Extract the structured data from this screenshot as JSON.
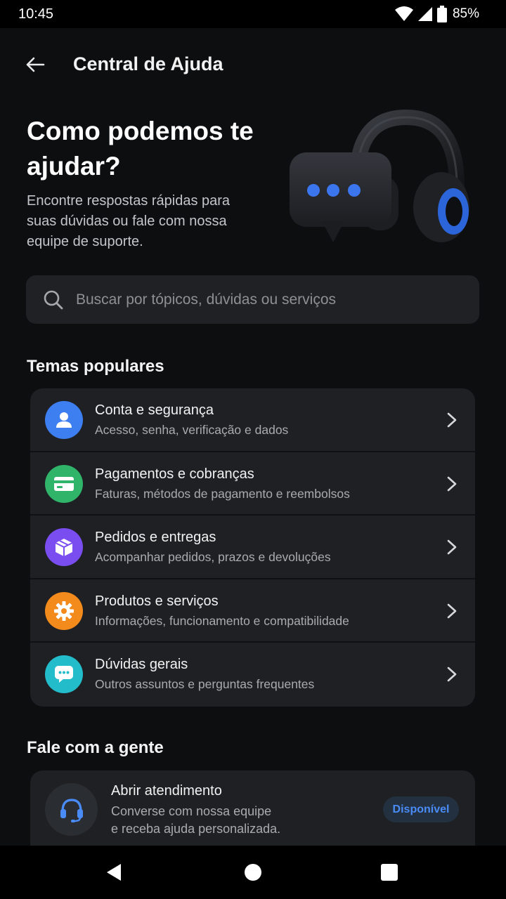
{
  "status_bar": {
    "time": "10:45",
    "battery": "85%"
  },
  "app_bar": {
    "title": "Central de Ajuda"
  },
  "hero": {
    "title": "Como podemos te ajudar?",
    "subtitle": "Encontre respostas rápidas para suas dúvidas ou fale com nossa equipe de suporte."
  },
  "search": {
    "placeholder": "Buscar por tópicos, dúvidas ou serviços"
  },
  "popular": {
    "heading": "Temas populares",
    "items": [
      {
        "title": "Conta e segurança",
        "description": "Acesso, senha, verificação e dados",
        "icon": "user-icon",
        "color": "#3d7ff0"
      },
      {
        "title": "Pagamentos e cobranças",
        "description": "Faturas, métodos de pagamento e reembolsos",
        "icon": "credit-card-icon",
        "color": "#2fb46a"
      },
      {
        "title": "Pedidos e entregas",
        "description": "Acompanhar pedidos, prazos e devoluções",
        "icon": "package-icon",
        "color": "#7a4df0"
      },
      {
        "title": "Produtos e serviços",
        "description": "Informações, funcionamento e compatibilidade",
        "icon": "gear-icon",
        "color": "#f28a1c"
      },
      {
        "title": "Dúvidas gerais",
        "description": "Outros assuntos e perguntas frequentes",
        "icon": "chat-icon",
        "color": "#23bccb"
      }
    ]
  },
  "contact": {
    "heading": "Fale com a gente",
    "title": "Abrir atendimento",
    "description_line1": "Converse com nossa equipe",
    "description_line2": "e receba ajuda personalizada.",
    "badge": "Disponível",
    "icon": "headset-icon",
    "accent": "#4a8cf7"
  }
}
